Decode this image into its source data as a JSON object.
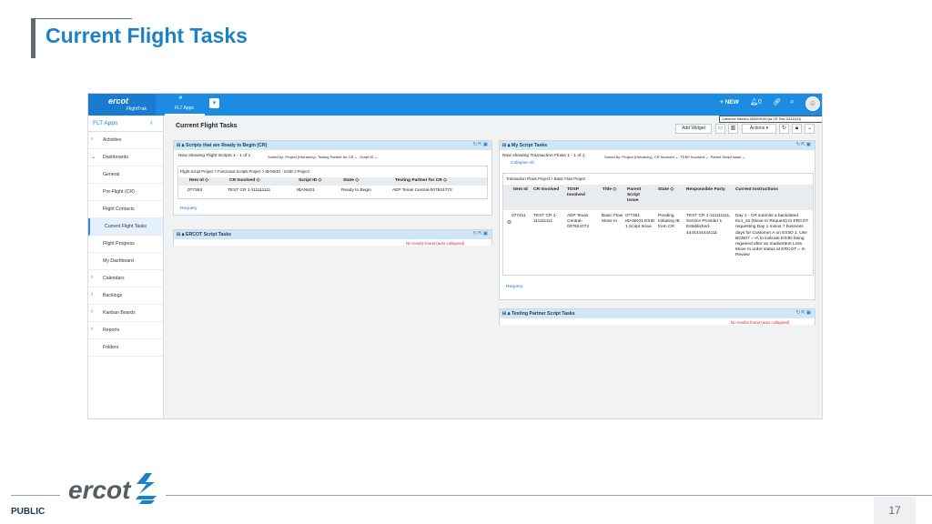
{
  "slide": {
    "title": "Current Flight Tasks",
    "footer_label": "PUBLIC",
    "logo_text": "ercot",
    "page_number": "17"
  },
  "app": {
    "logo_text": "ercot",
    "logo_sub": "FlightTrak",
    "apps_tab_label": "FLT Apps",
    "nav_new": "+ NEW",
    "nav_notifications": "0",
    "tooltip": "Catherine Meiners.18282/9049 (as CR Test-111111111)"
  },
  "sidebar": {
    "header": "FLT Apps",
    "items": [
      {
        "label": "Activities",
        "chevron": "›"
      },
      {
        "label": "Dashboards",
        "chevron": "⌄"
      },
      {
        "label": "General",
        "chevron": ""
      },
      {
        "label": "Pre-Flight (CR)",
        "chevron": ""
      },
      {
        "label": "Flight Contacts",
        "chevron": ""
      },
      {
        "label": "Current Flight Tasks",
        "chevron": "",
        "active": true
      },
      {
        "label": "Flight Progress",
        "chevron": ""
      },
      {
        "label": "My Dashboard",
        "chevron": ""
      },
      {
        "label": "Calendars",
        "chevron": "›"
      },
      {
        "label": "Backlogs",
        "chevron": "›"
      },
      {
        "label": "Kanban Boards",
        "chevron": "›"
      },
      {
        "label": "Reports",
        "chevron": "›"
      },
      {
        "label": "Folders",
        "chevron": ""
      }
    ]
  },
  "main": {
    "title": "Current Flight Tasks",
    "add_widget": "Add Widget",
    "actions": "Actions"
  },
  "scripts_panel": {
    "title": "Scripts that are Ready to Begin (CR)",
    "showing": "Now showing Flight Scripts 1 - 1 of 1",
    "sorted": "Sorted by: Project (Hierarchy). Testing Partner for CR ⌄. Script ID ⌄",
    "breadcrumb": "Flight Script Project > Functional Scripts Project > IBANK01 - ESID 2 Project",
    "columns": [
      "Item Id ◇",
      "CR Involved ◇",
      "Script ID ◇",
      "State ◇",
      "Testing Partner for CR ◇"
    ],
    "row": [
      "077363",
      "TEST CR 1-111111111",
      "IBANK01",
      "Ready to Begin",
      "AEP Texas Central-007924772"
    ],
    "requery": "Requery"
  },
  "ercot_panel": {
    "title": "ERCOT Script Tasks",
    "empty": "No results found (auto collapsed)"
  },
  "my_panel": {
    "title": "My Script Tasks",
    "showing": "Now showing Transaction Flows 1 - 1 of 1",
    "sorted": "Sorted by: Project (Hierarchy). CR Involved ⌄. TDSP Involved ⌄. Parent Script Issue ⌄",
    "collapse": "Collapse All",
    "breadcrumb": "Transaction Flows Project > Basic Flow Project",
    "columns": [
      "Item Id",
      "CR Involved",
      "TDSP Involved",
      "Title ◇",
      "Parent Script Issue",
      "State ◇",
      "Responsible Party",
      "Current Instructions"
    ],
    "row": {
      "item_id": "077411",
      "cr": "TEST CR 1-111111111",
      "tdsp": "AEP Texas Central-007924772",
      "title": "Basic Flow Move In",
      "parent": "077361 IBANK01 ESID 1 Script Issue",
      "state": "Pending Initiating IB from CR",
      "responsible": "TEST CR 1-111111111, Service Provider 1 Established-4444444444111",
      "instructions": "Day 1 - CR submits a backdated 814_16 (Move In Request) to ERCOT requesting Day 1 minus 7 business days for Customer A on ESIID 1. Use BGN07 = IA to indicate ESIID being regained after an Inadvertent Loss. Move In order status at ERCOT = In Review"
    },
    "requery": "Requery"
  },
  "tp_panel": {
    "title": "Testing Partner Script Tasks",
    "empty": "No results found (auto collapsed)"
  }
}
